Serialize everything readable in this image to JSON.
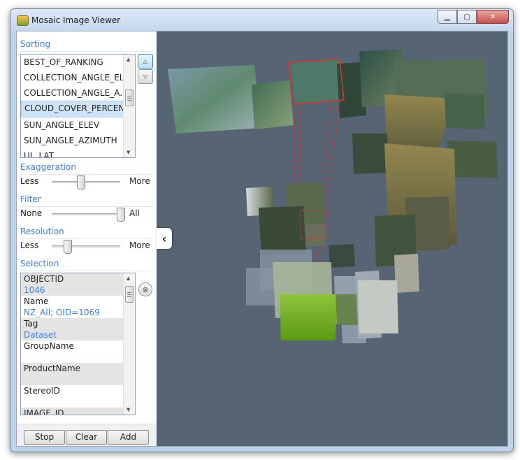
{
  "window": {
    "title": "Mosaic Image Viewer",
    "buttons": [
      "minimize",
      "maximize",
      "close"
    ]
  },
  "sorting": {
    "label": "Sorting",
    "items": [
      "BEST_OF_RANKING",
      "COLLECTION_ANGLE_EL...",
      "COLLECTION_ANGLE_A...",
      "CLOUD_COVER_PERCENT",
      "SUN_ANGLE_ELEV",
      "SUN_ANGLE_AZIMUTH",
      "UL_LAT"
    ],
    "selected_index": 3,
    "move_up_icon": "arrow-up-icon",
    "move_down_icon": "arrow-down-icon"
  },
  "exaggeration": {
    "label": "Exaggeration",
    "min_label": "Less",
    "max_label": "More",
    "value": 0.42
  },
  "filter": {
    "label": "Filter",
    "min_label": "None",
    "max_label": "All",
    "value": 1.0
  },
  "resolution": {
    "label": "Resolution",
    "min_label": "Less",
    "max_label": "More",
    "value": 0.22
  },
  "selection": {
    "label": "Selection",
    "fields": [
      {
        "name": "OBJECTID",
        "value": "1046"
      },
      {
        "name": "Name",
        "value": "NZ_All; OID=1069"
      },
      {
        "name": "Tag",
        "value": "Dataset"
      },
      {
        "name": "GroupName",
        "value": ""
      },
      {
        "name": "ProductName",
        "value": ""
      },
      {
        "name": "StereoID",
        "value": ""
      },
      {
        "name": "IMAGE_ID",
        "value": ""
      }
    ],
    "clear_icon": "clear-selection-icon"
  },
  "buttons": {
    "stop": "Stop",
    "clear": "Clear",
    "add": "Add"
  },
  "viewer": {
    "background": "#576474",
    "selected_outline": "#e03030",
    "highlight_tile": "#6fae1c",
    "collapse_icon": "chevron-left-icon"
  }
}
